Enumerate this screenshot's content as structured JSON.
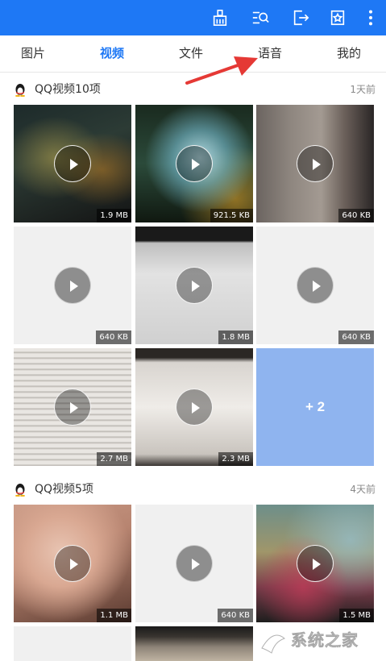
{
  "theme": {
    "accent": "#1e78f5",
    "annotation": "#e53935",
    "more_tile": "#8fb4ef"
  },
  "toolbar": {
    "icons": [
      "clean-icon",
      "search-list-icon",
      "export-icon",
      "bookmark-icon",
      "more-vertical-icon"
    ]
  },
  "tabs": [
    {
      "label": "图片",
      "active": false
    },
    {
      "label": "视频",
      "active": true
    },
    {
      "label": "文件",
      "active": false
    },
    {
      "label": "语音",
      "active": false
    },
    {
      "label": "我的",
      "active": false
    }
  ],
  "sections": [
    {
      "title": "QQ视频10项",
      "time": "1天前",
      "tiles": [
        {
          "size": "1.9 MB"
        },
        {
          "size": "921.5 KB"
        },
        {
          "size": "640 KB"
        },
        {
          "size": "640 KB"
        },
        {
          "size": "1.8 MB"
        },
        {
          "size": "640 KB"
        },
        {
          "size": "2.7 MB"
        },
        {
          "size": "2.3 MB"
        }
      ],
      "more_label": "+ 2"
    },
    {
      "title": "QQ视频5项",
      "time": "4天前",
      "tiles": [
        {
          "size": "1.1 MB"
        },
        {
          "size": "640 KB"
        },
        {
          "size": "1.5 MB"
        }
      ]
    }
  ],
  "watermark": {
    "text": "系统之家",
    "url": "xitongzhijia.net"
  }
}
